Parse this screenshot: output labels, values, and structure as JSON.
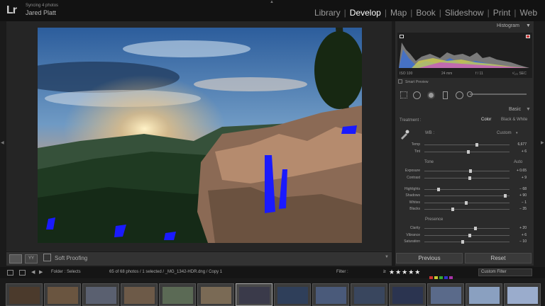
{
  "topbar": {
    "logo": "Lr",
    "sync_status": "Syncing 4 photos",
    "user_name": "Jared Platt",
    "modules": [
      "Library",
      "Develop",
      "Map",
      "Book",
      "Slideshow",
      "Print",
      "Web"
    ],
    "active_module": "Develop"
  },
  "histogram": {
    "title": "Histogram",
    "iso": "ISO 100",
    "focal": "24 mm",
    "aperture": "f / 11",
    "shutter": "¹⁄₁₂₅ SEC",
    "smart_preview": "Smart Preview"
  },
  "basic": {
    "title": "Basic",
    "treatment_label": "Treatment :",
    "treatment_color": "Color",
    "treatment_bw": "Black & White",
    "wb_label": "WB :",
    "wb_value": "Custom",
    "tone_label": "Tone",
    "auto_label": "Auto",
    "presence_label": "Presence",
    "sliders": [
      {
        "label": "Temp",
        "value": "6,677",
        "pos": 0.62
      },
      {
        "label": "Tint",
        "value": "+ 6",
        "pos": 0.52
      },
      {
        "label": "Exposure",
        "value": "+ 0.65",
        "pos": 0.54
      },
      {
        "label": "Contrast",
        "value": "+ 9",
        "pos": 0.53
      },
      {
        "label": "Highlights",
        "value": "− 68",
        "pos": 0.17
      },
      {
        "label": "Shadows",
        "value": "+ 90",
        "pos": 0.95
      },
      {
        "label": "Whites",
        "value": "− 1",
        "pos": 0.49
      },
      {
        "label": "Blacks",
        "value": "− 35",
        "pos": 0.33
      },
      {
        "label": "Clarity",
        "value": "+ 20",
        "pos": 0.6
      },
      {
        "label": "Vibrance",
        "value": "+ 6",
        "pos": 0.53
      },
      {
        "label": "Saturation",
        "value": "− 10",
        "pos": 0.45
      }
    ]
  },
  "buttons": {
    "previous": "Previous",
    "reset": "Reset"
  },
  "toolbar": {
    "soft_proofing": "Soft Proofing"
  },
  "filmbar": {
    "view_mode": "Folder : Selects",
    "counts": "65 of 68 photos / 1 selected / _MG_1342-HDR.dng / Copy 1",
    "filter_label": "Filter :",
    "rating_op": "≥",
    "stars": "★★★★★",
    "custom_filter": "Custom Filter"
  },
  "colors": {
    "background": "#1b1b1b",
    "panel": "#2b2b2b",
    "active_text": "#ffffff",
    "clipping_blue": "#1a1aff"
  }
}
